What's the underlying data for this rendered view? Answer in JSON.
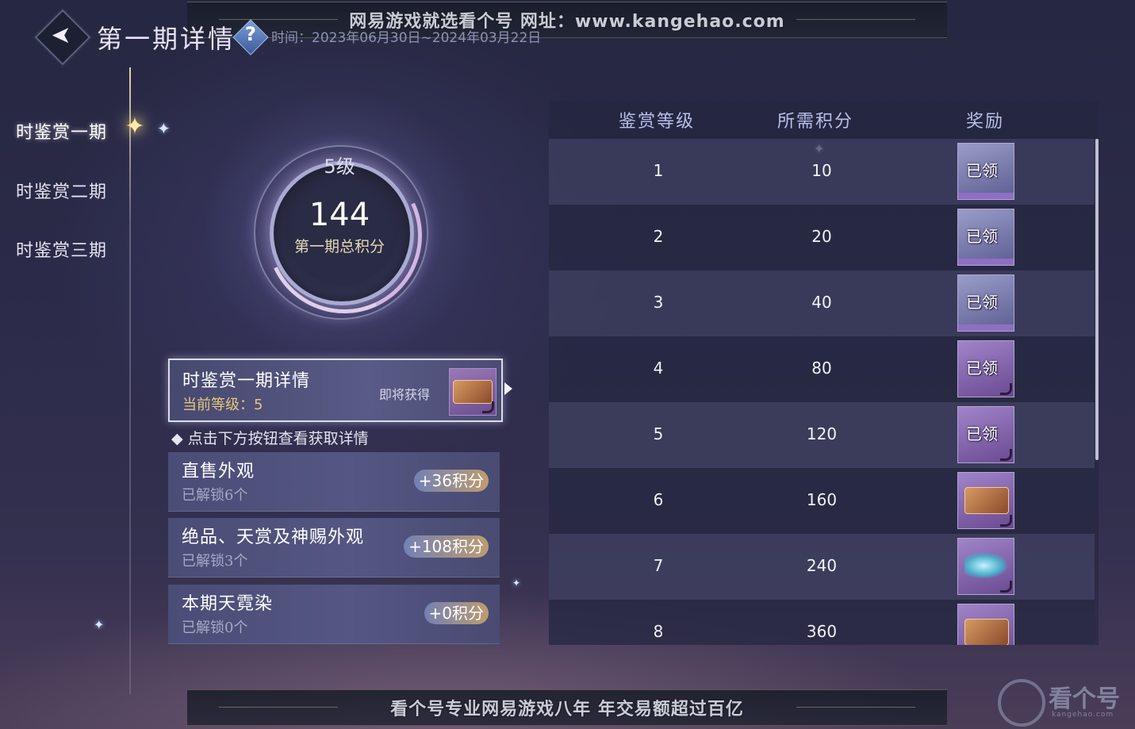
{
  "watermark": {
    "top": "网易游戏就选看个号  网址：www.kangehao.com",
    "bottom": "看个号专业网易游戏八年  年交易额超过百亿",
    "logo_text": "看个号",
    "logo_url": "kangehao.com"
  },
  "header": {
    "back_icon": "back-arrow-icon",
    "back_glyph": "➤",
    "title": "第一期详情",
    "help_glyph": "?",
    "time_label": "时间：2023年06月30日~2024年03月22日"
  },
  "sidebar": {
    "tabs": [
      {
        "label": "时鉴赏一期",
        "active": true
      },
      {
        "label": "时鉴赏二期",
        "active": false
      },
      {
        "label": "时鉴赏三期",
        "active": false
      }
    ],
    "active_marker_glyph": "✦"
  },
  "level_ring": {
    "level": "5级",
    "score": "144",
    "caption": "第一期总积分"
  },
  "detail_card": {
    "title": "时鉴赏一期详情",
    "level_label": "当前等级：",
    "level_value": "5",
    "upcoming_label": "即将获得"
  },
  "hint": "◆ 点击下方按钮查看获取详情",
  "sources": [
    {
      "title": "直售外观",
      "unlocked": "已解锁6个",
      "points": "+36积分"
    },
    {
      "title": "绝品、天赏及神赐外观",
      "unlocked": "已解锁3个",
      "points": "+108积分"
    },
    {
      "title": "本期天霓染",
      "unlocked": "已解锁0个",
      "points": "+0积分"
    }
  ],
  "table": {
    "headers": [
      "鉴赏等级",
      "所需积分",
      "奖励"
    ],
    "claimed_tag": "已领",
    "rows": [
      {
        "level": "1",
        "points": "10",
        "claimed": true,
        "icon": "gift-icon"
      },
      {
        "level": "2",
        "points": "20",
        "claimed": true,
        "icon": "gift-icon"
      },
      {
        "level": "3",
        "points": "40",
        "claimed": true,
        "icon": "gift-icon"
      },
      {
        "level": "4",
        "points": "80",
        "claimed": true,
        "icon": "gift-icon"
      },
      {
        "level": "5",
        "points": "120",
        "claimed": true,
        "icon": "gift-icon"
      },
      {
        "level": "6",
        "points": "160",
        "claimed": false,
        "icon": "box-icon"
      },
      {
        "level": "7",
        "points": "240",
        "claimed": false,
        "icon": "fish-icon"
      },
      {
        "level": "8",
        "points": "360",
        "claimed": false,
        "icon": "box-icon"
      }
    ]
  },
  "colors": {
    "accent_gold": "#e8c77a",
    "header_blue": "#b7c0ea",
    "reward_purple": "#8e6fc4"
  }
}
